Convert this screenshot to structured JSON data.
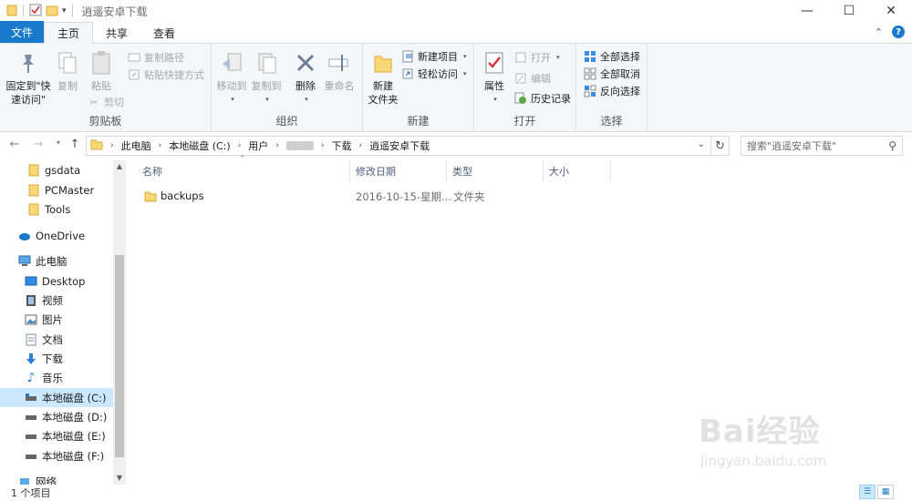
{
  "window": {
    "title": "逍遥安卓下载",
    "controls": {
      "minimize": "—",
      "maximize": "☐",
      "close": "✕"
    }
  },
  "tabs": [
    {
      "label": "文件"
    },
    {
      "label": "主页"
    },
    {
      "label": "共享"
    },
    {
      "label": "查看"
    }
  ],
  "ribbon": {
    "clipboard": {
      "label": "剪贴板",
      "pin": "固定到\"快\n速访问\"",
      "copy": "复制",
      "paste": "粘贴",
      "copy_path": "复制路径",
      "paste_shortcut": "粘贴快捷方式",
      "cut": "剪切"
    },
    "organize": {
      "label": "组织",
      "move_to": "移动到",
      "copy_to": "复制到",
      "delete": "删除",
      "rename": "重命名"
    },
    "new": {
      "label": "新建",
      "new_folder": "新建\n文件夹",
      "new_item": "新建项目",
      "easy_access": "轻松访问"
    },
    "open": {
      "label": "打开",
      "properties": "属性",
      "open": "打开",
      "edit": "编辑",
      "history": "历史记录"
    },
    "select": {
      "label": "选择",
      "select_all": "全部选择",
      "select_none": "全部取消",
      "invert": "反向选择"
    }
  },
  "address": {
    "crumbs": [
      "此电脑",
      "本地磁盘 (C:)",
      "用户",
      "",
      "下载",
      "逍遥安卓下载"
    ],
    "search_placeholder": "搜索\"逍遥安卓下载\""
  },
  "nav": {
    "items": [
      {
        "label": "gsdata",
        "icon": "folder-icon"
      },
      {
        "label": "PCMaster",
        "icon": "folder-icon"
      },
      {
        "label": "Tools",
        "icon": "folder-icon"
      },
      {
        "label": "OneDrive",
        "icon": "cloud-icon"
      },
      {
        "label": "此电脑",
        "icon": "computer-icon"
      },
      {
        "label": "Desktop",
        "icon": "desktop-icon"
      },
      {
        "label": "视频",
        "icon": "video-icon"
      },
      {
        "label": "图片",
        "icon": "picture-icon"
      },
      {
        "label": "文档",
        "icon": "document-icon"
      },
      {
        "label": "下载",
        "icon": "download-icon"
      },
      {
        "label": "音乐",
        "icon": "music-icon"
      },
      {
        "label": "本地磁盘 (C:)",
        "icon": "drive-icon"
      },
      {
        "label": "本地磁盘 (D:)",
        "icon": "drive-icon"
      },
      {
        "label": "本地磁盘 (E:)",
        "icon": "drive-icon"
      },
      {
        "label": "本地磁盘 (F:)",
        "icon": "drive-icon"
      },
      {
        "label": "网络",
        "icon": "network-icon"
      }
    ]
  },
  "columns": [
    "名称",
    "修改日期",
    "类型",
    "大小"
  ],
  "files": [
    {
      "name": "backups",
      "modified": "2016-10-15-星期...",
      "type": "文件夹",
      "size": ""
    }
  ],
  "status": {
    "count": "1 个项目"
  },
  "watermark": {
    "brand": "Bai经验",
    "url": "jingyan.baidu.com"
  },
  "colors": {
    "accent": "#1979ca",
    "selection": "#cce8ff",
    "folder": "#f8d775"
  }
}
